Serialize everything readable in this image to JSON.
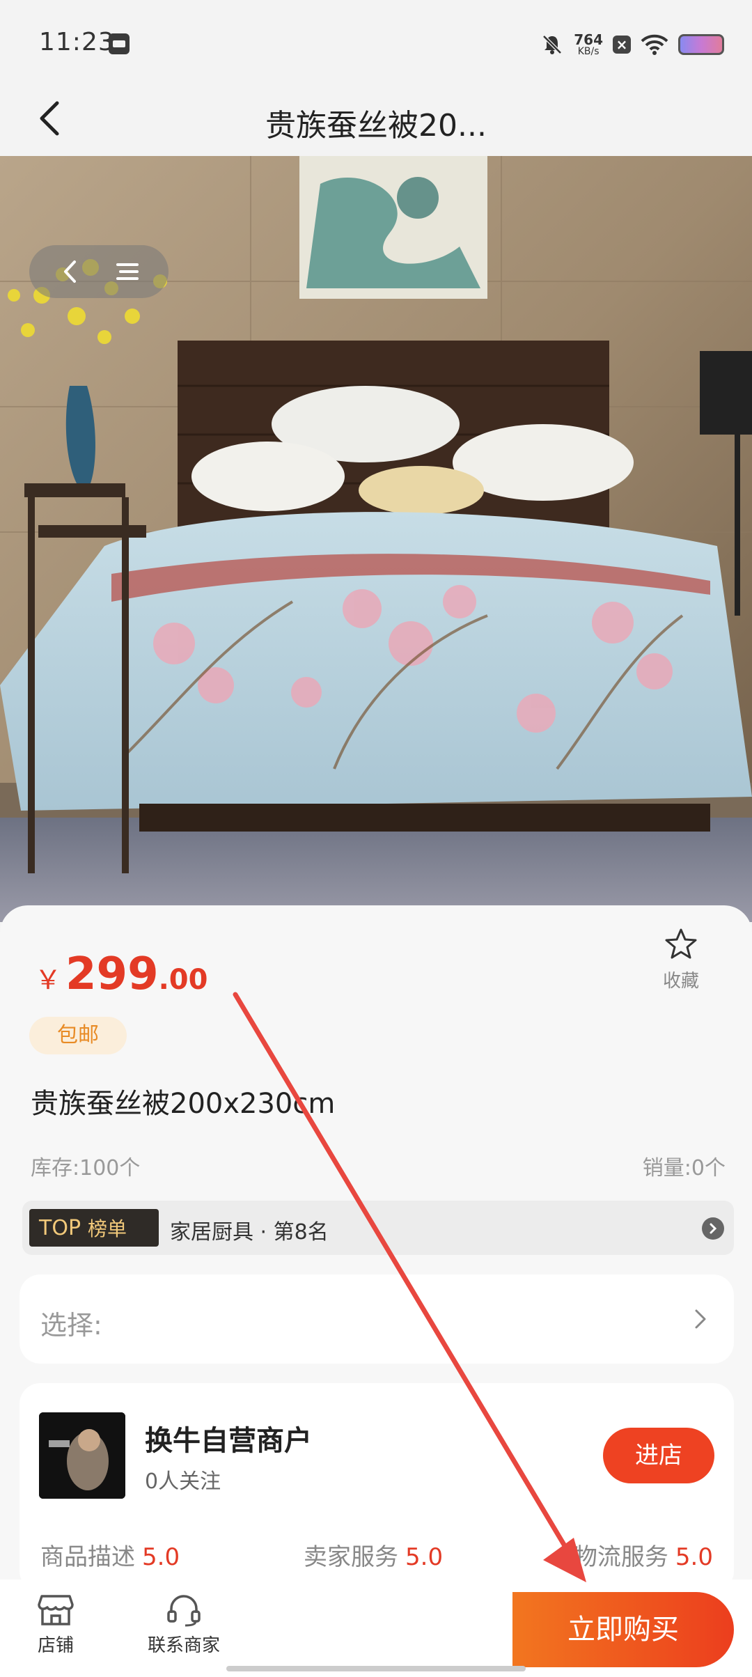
{
  "status_bar": {
    "time": "11:23",
    "net_speed_value": "764",
    "net_speed_unit": "KB/s",
    "icons": [
      "notification-off-icon",
      "close-box-icon",
      "wifi-icon",
      "battery-icon"
    ]
  },
  "header": {
    "title": "贵族蚕丝被20..."
  },
  "product": {
    "price_currency": "￥",
    "price_integer": "299",
    "price_decimal": ".00",
    "favorite_label": "收藏",
    "free_shipping_badge": "包邮",
    "title": "贵族蚕丝被200x230cm",
    "stock": "库存:100个",
    "sales": "销量:0个",
    "rank": {
      "tag_top": "TOP",
      "tag_label": "榜单",
      "text": "家居厨具 · 第8名"
    },
    "select_label": "选择:"
  },
  "shop": {
    "name": "换牛自营商户",
    "followers": "0人关注",
    "enter_button": "进店",
    "scores": [
      {
        "label": "商品描述",
        "value": "5.0"
      },
      {
        "label": "卖家服务",
        "value": "5.0"
      },
      {
        "label": "物流服务",
        "value": "5.0"
      }
    ]
  },
  "bottom_bar": {
    "shop_label": "店铺",
    "contact_label": "联系商家",
    "buy_button": "立即购买"
  },
  "colors": {
    "accent_red": "#e33a25",
    "buy_gradient_start": "#f2761f",
    "buy_gradient_end": "#ec3e1e",
    "annotation_arrow": "#e8473f"
  }
}
